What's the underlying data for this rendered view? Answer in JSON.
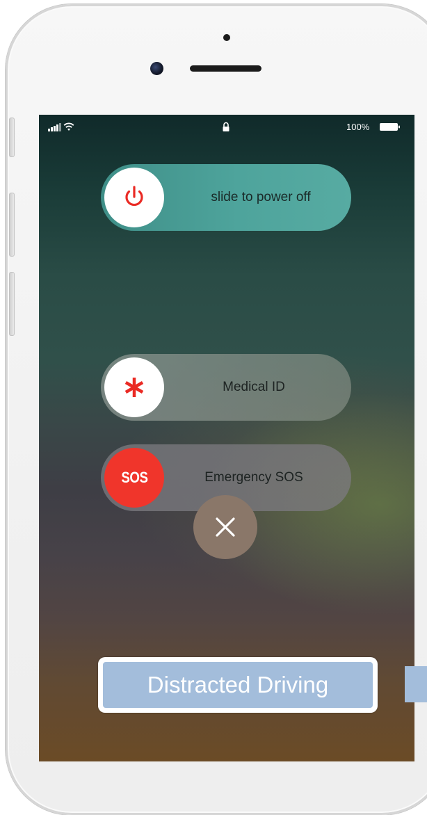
{
  "status_bar": {
    "signal_icon": "cellular-signal-icon",
    "wifi_icon": "wifi-icon",
    "lock_icon": "lock-icon",
    "battery_percent": "100%",
    "battery_icon": "battery-full-icon"
  },
  "power_slider": {
    "label": "slide to power off",
    "icon": "power-icon",
    "icon_color": "#ea2a24"
  },
  "medical_slider": {
    "label": "Medical ID",
    "icon": "asterisk-icon",
    "icon_color": "#ea2a24"
  },
  "sos_slider": {
    "label": "Emergency SOS",
    "knob_text": "SOS",
    "knob_color": "#f0352b"
  },
  "cancel": {
    "icon": "close-icon"
  },
  "caption": {
    "text": "Distracted Driving",
    "color": "#a3bddb"
  }
}
